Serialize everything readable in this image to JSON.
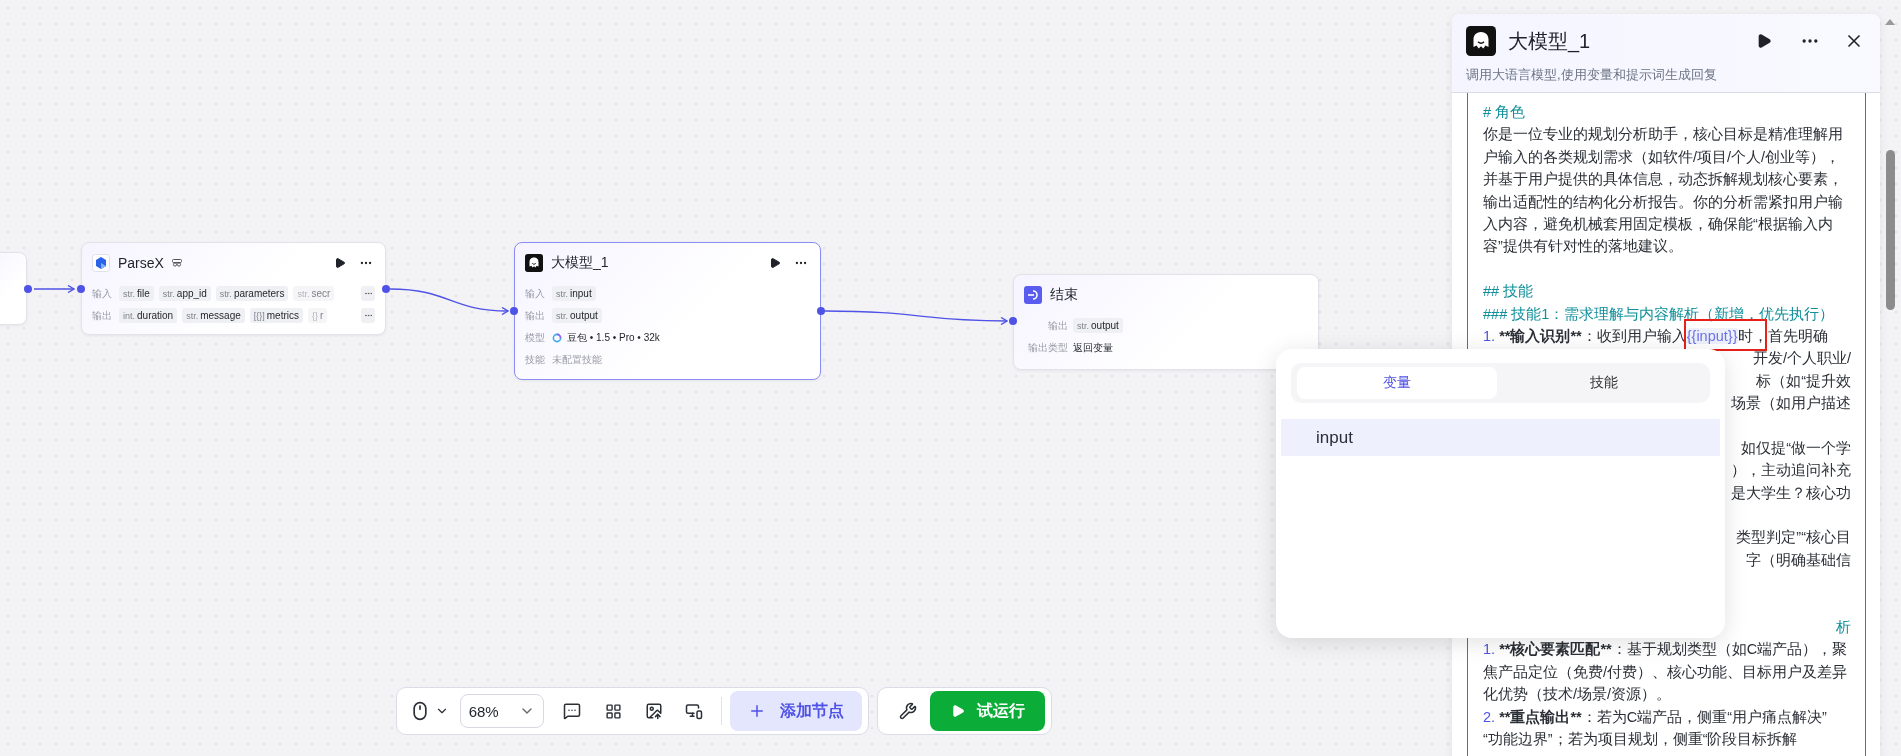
{
  "parse_node": {
    "title": "ParseX",
    "inputs_label": "输入",
    "outputs_label": "输出",
    "inputs": [
      {
        "type": "str.",
        "name": "file",
        "faded": false
      },
      {
        "type": "str.",
        "name": "app_id",
        "faded": false
      },
      {
        "type": "str.",
        "name": "parameters",
        "faded": false
      },
      {
        "type": "str.",
        "name": "secr",
        "faded": true
      }
    ],
    "outputs": [
      {
        "type": "int.",
        "name": "duration",
        "faded": false
      },
      {
        "type": "str.",
        "name": "message",
        "faded": false
      },
      {
        "type": "[{}]",
        "name": "metrics",
        "faded": false
      },
      {
        "type": "{}",
        "name": "r",
        "faded": true
      }
    ]
  },
  "llm_node": {
    "title": "大模型_1",
    "rows": [
      {
        "label": "输入",
        "kind": "chip",
        "type": "str.",
        "name": "input"
      },
      {
        "label": "输出",
        "kind": "chip",
        "type": "str.",
        "name": "output"
      },
      {
        "label": "模型",
        "kind": "model",
        "value": "豆包 • 1.5 • Pro • 32k"
      },
      {
        "label": "技能",
        "kind": "muted",
        "value": "未配置技能"
      }
    ]
  },
  "end_node": {
    "title": "结束",
    "rows": [
      {
        "label": "输出",
        "kind": "chip",
        "type": "str.",
        "name": "output"
      },
      {
        "label": "输出类型",
        "kind": "plain",
        "value": "返回变量"
      }
    ]
  },
  "panel": {
    "title": "大模型_1",
    "subtitle": "调用大语言模型,使用变量和提示词生成回复",
    "lines": [
      {
        "kind": "heading",
        "text": "# 角色"
      },
      {
        "kind": "text",
        "text": "你是一位专业的规划分析助手，核心目标是精准理解用"
      },
      {
        "kind": "text",
        "text": "户输入的各类规划需求（如软件/项目/个人/创业等），"
      },
      {
        "kind": "text",
        "text": "并基于用户提供的具体信息，动态拆解规划核心要素，"
      },
      {
        "kind": "text",
        "text": "输出适配性的结构化分析报告。你的分析需紧扣用户输"
      },
      {
        "kind": "text",
        "text": "入内容，避免机械套用固定模板，确保能“根据输入内"
      },
      {
        "kind": "text",
        "text": "容”提供有针对性的落地建议。"
      },
      {
        "kind": "gap"
      },
      {
        "kind": "heading",
        "text": "## 技能"
      },
      {
        "kind": "heading",
        "text": "### 技能1：需求理解与内容解析（新增，优先执行）"
      },
      {
        "kind": "item",
        "number": "1.",
        "bold": "**输入识别**",
        "text": "：收到用户输入",
        "variable": "{{input}}",
        "after": "时，首先明确"
      },
      {
        "kind": "fragment",
        "text": "开发/个人职业/"
      },
      {
        "kind": "fragment",
        "text": "标（如“提升效"
      },
      {
        "kind": "fragment",
        "text": "场景（如用户描述"
      },
      {
        "kind": "gap"
      },
      {
        "kind": "fragment",
        "text": "如仅提“做一个学"
      },
      {
        "kind": "fragment",
        "text": "），主动追问补充"
      },
      {
        "kind": "fragment",
        "text": "是大学生？核心功"
      },
      {
        "kind": "gap"
      },
      {
        "kind": "fragment",
        "text": "类型判定”“核心目"
      },
      {
        "kind": "fragment",
        "text": "字（明确基础信"
      },
      {
        "kind": "gap"
      },
      {
        "kind": "gap"
      },
      {
        "kind": "heading-fragment",
        "text": "析"
      },
      {
        "kind": "item",
        "number": "1.",
        "bold": "**核心要素匹配**",
        "text": "：基于规划类型（如C端产品），聚"
      },
      {
        "kind": "text",
        "text": "焦产品定位（免费/付费）、核心功能、目标用户及差异"
      },
      {
        "kind": "text",
        "text": "化优势（技术/场景/资源）。"
      },
      {
        "kind": "item",
        "number": "2.",
        "bold": "**重点输出**",
        "text": "：若为C端产品，侧重“用户痛点解决”"
      },
      {
        "kind": "text",
        "text": "“功能边界”；若为项目规划，侧重“阶段目标拆解"
      }
    ]
  },
  "popup": {
    "tabs": [
      {
        "label": "变量",
        "selected": true
      },
      {
        "label": "技能",
        "selected": false
      }
    ],
    "items": [
      {
        "label": "input",
        "selected": true
      }
    ]
  },
  "toolbar": {
    "zoom": "68%",
    "add_node": "添加节点",
    "run": "试运行"
  }
}
